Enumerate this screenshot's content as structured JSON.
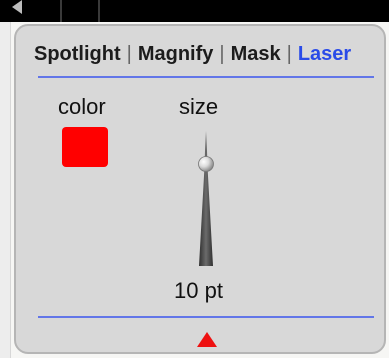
{
  "tabs": [
    {
      "label": "Spotlight",
      "active": false
    },
    {
      "label": "Magnify",
      "active": false
    },
    {
      "label": "Mask",
      "active": false
    },
    {
      "label": "Laser",
      "active": true
    }
  ],
  "laser": {
    "color_label": "color",
    "size_label": "size",
    "color_value": "#ff0000",
    "size_value": "10 pt",
    "size_level": 0.2
  },
  "icons": {
    "collapse": "red-up-triangle-icon",
    "slider": "size-slider-icon"
  },
  "colors": {
    "accent": "#2a4be8",
    "rule": "#6276e8",
    "laser_red": "#ff0000",
    "panel": "#d8d8d8"
  }
}
